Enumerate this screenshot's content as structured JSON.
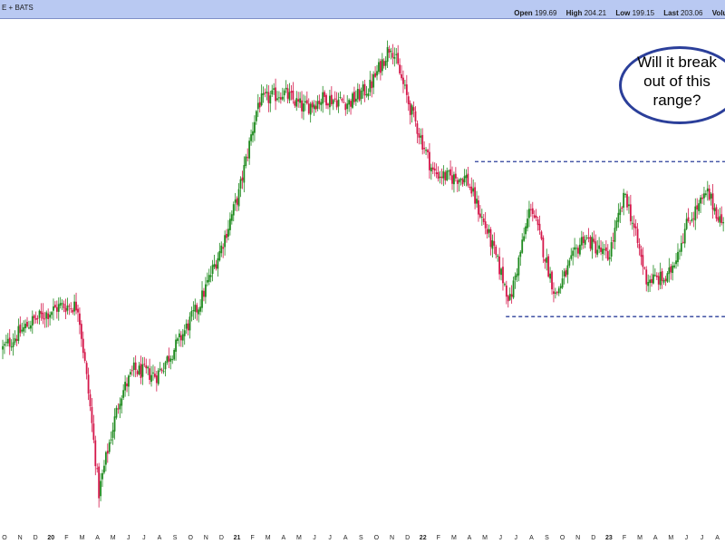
{
  "header": {
    "symbol_fragment": "E + BATS",
    "open_label": "Open",
    "open_value": "199.69",
    "high_label": "High",
    "high_value": "204.21",
    "low_label": "Low",
    "low_value": "199.15",
    "last_label": "Last",
    "last_value": "203.06",
    "volume_label": "Volume"
  },
  "annotation": {
    "text": "Will it break out of this range?"
  },
  "colors": {
    "up": "#1e8a1e",
    "down": "#d4174a",
    "range_line": "#2b3f9a",
    "header_bg": "#b9c9f2"
  },
  "chart_data": {
    "type": "candlestick",
    "title": "",
    "xlabel": "",
    "ylabel": "",
    "ylim": [
      5,
      100
    ],
    "grid": false,
    "x_tick_labels": [
      "O",
      "N",
      "D",
      "20",
      "F",
      "M",
      "A",
      "M",
      "J",
      "J",
      "A",
      "S",
      "O",
      "N",
      "D",
      "21",
      "F",
      "M",
      "A",
      "M",
      "J",
      "J",
      "A",
      "S",
      "O",
      "N",
      "D",
      "22",
      "F",
      "M",
      "A",
      "M",
      "J",
      "J",
      "A",
      "S",
      "O",
      "N",
      "D",
      "23",
      "F",
      "M",
      "A",
      "M",
      "J",
      "J",
      "A"
    ],
    "range_lines": [
      {
        "level": 74,
        "start_label": "A",
        "style": "dashed"
      },
      {
        "level": 45,
        "start_label": "J",
        "style": "dashed"
      }
    ],
    "anchors": [
      {
        "t": 0,
        "price": 39
      },
      {
        "t": 16,
        "price": 44
      },
      {
        "t": 33,
        "price": 47
      },
      {
        "t": 43,
        "price": 47
      },
      {
        "t": 50,
        "price": 28
      },
      {
        "t": 55,
        "price": 12
      },
      {
        "t": 60,
        "price": 20
      },
      {
        "t": 67,
        "price": 30
      },
      {
        "t": 75,
        "price": 35
      },
      {
        "t": 88,
        "price": 34
      },
      {
        "t": 100,
        "price": 40
      },
      {
        "t": 112,
        "price": 47
      },
      {
        "t": 125,
        "price": 58
      },
      {
        "t": 135,
        "price": 68
      },
      {
        "t": 146,
        "price": 85
      },
      {
        "t": 160,
        "price": 87
      },
      {
        "t": 172,
        "price": 84
      },
      {
        "t": 184,
        "price": 86
      },
      {
        "t": 198,
        "price": 85
      },
      {
        "t": 210,
        "price": 88
      },
      {
        "t": 222,
        "price": 96
      },
      {
        "t": 232,
        "price": 85
      },
      {
        "t": 246,
        "price": 72
      },
      {
        "t": 255,
        "price": 71
      },
      {
        "t": 265,
        "price": 71
      },
      {
        "t": 278,
        "price": 60
      },
      {
        "t": 290,
        "price": 48
      },
      {
        "t": 302,
        "price": 66
      },
      {
        "t": 316,
        "price": 49
      },
      {
        "t": 332,
        "price": 60
      },
      {
        "t": 346,
        "price": 56
      },
      {
        "t": 356,
        "price": 68
      },
      {
        "t": 368,
        "price": 52
      },
      {
        "t": 380,
        "price": 52
      },
      {
        "t": 392,
        "price": 63
      },
      {
        "t": 403,
        "price": 68
      },
      {
        "t": 412,
        "price": 62
      }
    ]
  }
}
